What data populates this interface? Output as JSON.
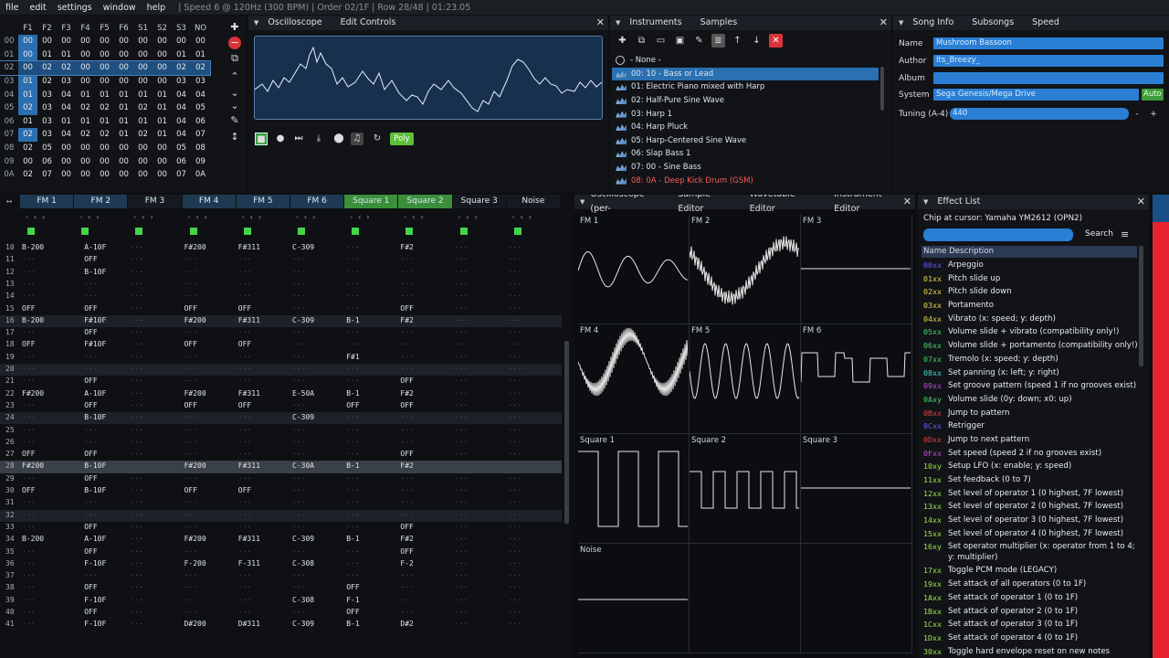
{
  "menu": {
    "items": [
      "file",
      "edit",
      "settings",
      "window",
      "help"
    ],
    "status": "| Speed 6 @ 120Hz (300 BPM) | Order 02/1F | Row 28/48 | 01:23.05"
  },
  "orders": {
    "headers": [
      "F1",
      "F2",
      "F3",
      "F4",
      "F5",
      "F6",
      "S1",
      "S2",
      "S3",
      "NO"
    ],
    "rows": [
      [
        "00",
        "00",
        "00",
        "00",
        "00",
        "00",
        "00",
        "00",
        "00",
        "00",
        "00"
      ],
      [
        "01",
        "00",
        "01",
        "01",
        "00",
        "00",
        "00",
        "00",
        "00",
        "01",
        "01"
      ],
      [
        "02",
        "00",
        "02",
        "02",
        "00",
        "00",
        "00",
        "00",
        "00",
        "02",
        "02"
      ],
      [
        "03",
        "01",
        "02",
        "03",
        "00",
        "00",
        "00",
        "00",
        "00",
        "03",
        "03"
      ],
      [
        "04",
        "01",
        "03",
        "04",
        "01",
        "01",
        "01",
        "01",
        "01",
        "04",
        "04"
      ],
      [
        "05",
        "02",
        "03",
        "04",
        "02",
        "02",
        "01",
        "02",
        "01",
        "04",
        "05"
      ],
      [
        "06",
        "01",
        "03",
        "01",
        "01",
        "01",
        "01",
        "01",
        "01",
        "04",
        "06"
      ],
      [
        "07",
        "02",
        "03",
        "04",
        "02",
        "02",
        "01",
        "02",
        "01",
        "04",
        "07"
      ],
      [
        "08",
        "02",
        "05",
        "00",
        "00",
        "00",
        "00",
        "00",
        "00",
        "05",
        "08"
      ],
      [
        "09",
        "00",
        "06",
        "00",
        "00",
        "00",
        "00",
        "00",
        "00",
        "06",
        "09"
      ],
      [
        "0A",
        "02",
        "07",
        "00",
        "00",
        "00",
        "00",
        "00",
        "00",
        "07",
        "0A"
      ]
    ]
  },
  "scope_panel": {
    "tabs": [
      "Oscilloscope",
      "Edit Controls"
    ],
    "poly_label": "Poly"
  },
  "instruments": {
    "tabs": [
      "Instruments",
      "Samples"
    ],
    "none_label": "- None -",
    "items": [
      "00: 10 - Bass or Lead",
      "01: Electric Piano mixed with Harp",
      "02: Half-Pure Sine Wave",
      "03: Harp 1",
      "04: Harp Pluck",
      "05: Harp-Centered Sine Wave",
      "06: Slap Bass 1",
      "07: 00 - Sine Bass",
      "08: 0A - Deep Kick Drum (GSM)"
    ]
  },
  "song_info": {
    "tabs": [
      "Song Info",
      "Subsongs",
      "Speed"
    ],
    "name_label": "Name",
    "name": "Mushroom Bassoon",
    "author_label": "Author",
    "author": "Its_Breezy_",
    "album_label": "Album",
    "album": "",
    "system_label": "System",
    "system": "Sega Genesis/Mega Drive",
    "auto": "Auto",
    "tuning_label": "Tuning (A-4)",
    "tuning": "440"
  },
  "pattern": {
    "channels": [
      "FM 1",
      "FM 2",
      "FM 3",
      "FM 4",
      "FM 5",
      "FM 6",
      "Square 1",
      "Square 2",
      "Square 3",
      "Noise"
    ],
    "rows": [
      {
        "n": "10",
        "c": {
          "0": "B-200",
          "1": "A-10F",
          "3": "F#200",
          "4": "F#311",
          "5": "C-309",
          "7": "F#2"
        }
      },
      {
        "n": "11",
        "c": {
          "1": "OFF"
        }
      },
      {
        "n": "12",
        "c": {
          "1": "B-10F"
        }
      },
      {
        "n": "13",
        "c": {}
      },
      {
        "n": "14",
        "c": {}
      },
      {
        "n": "15",
        "c": {
          "0": "OFF",
          "1": "OFF",
          "3": "OFF",
          "4": "OFF",
          "7": "OFF"
        }
      },
      {
        "n": "16",
        "c": {
          "0": "B-200",
          "1": "F#10F",
          "3": "F#200",
          "4": "F#311",
          "5": "C-309",
          "6": "B-1",
          "7": "F#2"
        }
      },
      {
        "n": "17",
        "c": {
          "1": "OFF"
        }
      },
      {
        "n": "18",
        "c": {
          "0": "OFF",
          "1": "F#10F",
          "3": "OFF",
          "4": "OFF"
        }
      },
      {
        "n": "19",
        "c": {
          "6": "F#1"
        }
      },
      {
        "n": "20",
        "c": {}
      },
      {
        "n": "21",
        "c": {
          "1": "OFF",
          "7": "OFF"
        }
      },
      {
        "n": "22",
        "c": {
          "0": "F#200",
          "1": "A-10F",
          "3": "F#200",
          "4": "F#311",
          "5": "E-50A",
          "6": "B-1",
          "7": "F#2"
        }
      },
      {
        "n": "23",
        "c": {
          "1": "OFF",
          "3": "OFF",
          "4": "OFF",
          "6": "OFF",
          "7": "OFF"
        }
      },
      {
        "n": "24",
        "c": {
          "1": "B-10F",
          "5": "C-309"
        }
      },
      {
        "n": "25",
        "c": {}
      },
      {
        "n": "26",
        "c": {}
      },
      {
        "n": "27",
        "c": {
          "0": "OFF",
          "1": "OFF",
          "7": "OFF"
        }
      },
      {
        "n": "28",
        "c": {
          "0": "F#200",
          "1": "B-10F",
          "3": "F#200",
          "4": "F#311",
          "5": "C-30A",
          "6": "B-1",
          "7": "F#2"
        }
      },
      {
        "n": "29",
        "c": {
          "1": "OFF"
        }
      },
      {
        "n": "30",
        "c": {
          "0": "OFF",
          "1": "B-10F",
          "3": "OFF",
          "4": "OFF"
        }
      },
      {
        "n": "31",
        "c": {}
      },
      {
        "n": "32",
        "c": {}
      },
      {
        "n": "33",
        "c": {
          "1": "OFF",
          "7": "OFF"
        }
      },
      {
        "n": "34",
        "c": {
          "0": "B-200",
          "1": "A-10F",
          "3": "F#200",
          "4": "F#311",
          "5": "C-309",
          "6": "B-1",
          "7": "F#2"
        }
      },
      {
        "n": "35",
        "c": {
          "1": "OFF",
          "7": "OFF"
        }
      },
      {
        "n": "36",
        "c": {
          "1": "F-10F",
          "3": "F-200",
          "4": "F-311",
          "5": "C-308",
          "7": "F-2"
        }
      },
      {
        "n": "37",
        "c": {}
      },
      {
        "n": "38",
        "c": {
          "1": "OFF",
          "6": "OFF"
        }
      },
      {
        "n": "39",
        "c": {
          "1": "F-10F",
          "5": "C-308",
          "6": "F-1"
        }
      },
      {
        "n": "40",
        "c": {
          "1": "OFF",
          "6": "OFF"
        }
      },
      {
        "n": "41",
        "c": {
          "1": "F-10F",
          "3": "D#200",
          "4": "D#311",
          "5": "C-309",
          "6": "B-1",
          "7": "D#2"
        }
      }
    ]
  },
  "osc_panel": {
    "tabs": [
      "Oscilloscope (per-",
      "Sample Editor",
      "Wavetable Editor",
      "Instrument Editor"
    ],
    "cells": [
      "FM 1",
      "FM 2",
      "FM 3",
      "FM 4",
      "FM 5",
      "FM 6",
      "Square 1",
      "Square 2",
      "Square 3",
      "Noise"
    ]
  },
  "effects": {
    "tab": "Effect List",
    "chip": "Chip at cursor: Yamaha YM2612 (OPN2)",
    "search": "Search",
    "header": "Name Description",
    "items": [
      {
        "code": "00xx",
        "desc": "Arpeggio",
        "color": "#6a5cff"
      },
      {
        "code": "01xx",
        "desc": "Pitch slide up",
        "color": "#e8d34a"
      },
      {
        "code": "02xx",
        "desc": "Pitch slide down",
        "color": "#e8d34a"
      },
      {
        "code": "03xx",
        "desc": "Portamento",
        "color": "#e8d34a"
      },
      {
        "code": "04xx",
        "desc": "Vibrato (x: speed; y: depth)",
        "color": "#e8d34a"
      },
      {
        "code": "05xx",
        "desc": "Volume slide + vibrato (compatibility only!)",
        "color": "#46d46a"
      },
      {
        "code": "06xx",
        "desc": "Volume slide + portamento (compatibility only!)",
        "color": "#46d46a"
      },
      {
        "code": "07xx",
        "desc": "Tremolo (x: speed; y: depth)",
        "color": "#46d46a"
      },
      {
        "code": "08xx",
        "desc": "Set panning (x: left; y: right)",
        "color": "#46d4c8"
      },
      {
        "code": "09xx",
        "desc": "Set groove pattern (speed 1 if no grooves exist)",
        "color": "#c44ad4"
      },
      {
        "code": "0Axy",
        "desc": "Volume slide (0y: down; x0: up)",
        "color": "#46d46a"
      },
      {
        "code": "0Bxx",
        "desc": "Jump to pattern",
        "color": "#e04040"
      },
      {
        "code": "0Cxx",
        "desc": "Retrigger",
        "color": "#6a5cff"
      },
      {
        "code": "0Dxx",
        "desc": "Jump to next pattern",
        "color": "#e04040"
      },
      {
        "code": "0Fxx",
        "desc": "Set speed (speed 2 if no grooves exist)",
        "color": "#c44ad4"
      },
      {
        "code": "10xy",
        "desc": "Setup LFO (x: enable; y: speed)",
        "color": "#a0e04a"
      },
      {
        "code": "11xx",
        "desc": "Set feedback (0 to 7)",
        "color": "#a0e04a"
      },
      {
        "code": "12xx",
        "desc": "Set level of operator 1 (0 highest, 7F lowest)",
        "color": "#a0e04a"
      },
      {
        "code": "13xx",
        "desc": "Set level of operator 2 (0 highest, 7F lowest)",
        "color": "#a0e04a"
      },
      {
        "code": "14xx",
        "desc": "Set level of operator 3 (0 highest, 7F lowest)",
        "color": "#a0e04a"
      },
      {
        "code": "15xx",
        "desc": "Set level of operator 4 (0 highest, 7F lowest)",
        "color": "#a0e04a"
      },
      {
        "code": "16xy",
        "desc": "Set operator multiplier (x: operator from 1 to 4; y: multiplier)",
        "color": "#a0e04a",
        "two": true
      },
      {
        "code": "17xx",
        "desc": "Toggle PCM mode (LEGACY)",
        "color": "#a0e04a"
      },
      {
        "code": "19xx",
        "desc": "Set attack of all operators (0 to 1F)",
        "color": "#a0e04a"
      },
      {
        "code": "1Axx",
        "desc": "Set attack of operator 1 (0 to 1F)",
        "color": "#a0e04a"
      },
      {
        "code": "1Bxx",
        "desc": "Set attack of operator 2 (0 to 1F)",
        "color": "#a0e04a"
      },
      {
        "code": "1Cxx",
        "desc": "Set attack of operator 3 (0 to 1F)",
        "color": "#a0e04a"
      },
      {
        "code": "1Dxx",
        "desc": "Set attack of operator 4 (0 to 1F)",
        "color": "#a0e04a"
      },
      {
        "code": "30xx",
        "desc": "Toggle hard envelope reset on new notes",
        "color": "#a0e04a"
      }
    ]
  },
  "colors": {
    "accent": "#2a7ed4",
    "selection": "#2a6fb0",
    "square_hdr": "#3b8f3b",
    "fm_hdr": "#1e3a52",
    "red_strip": "#e8222e"
  }
}
